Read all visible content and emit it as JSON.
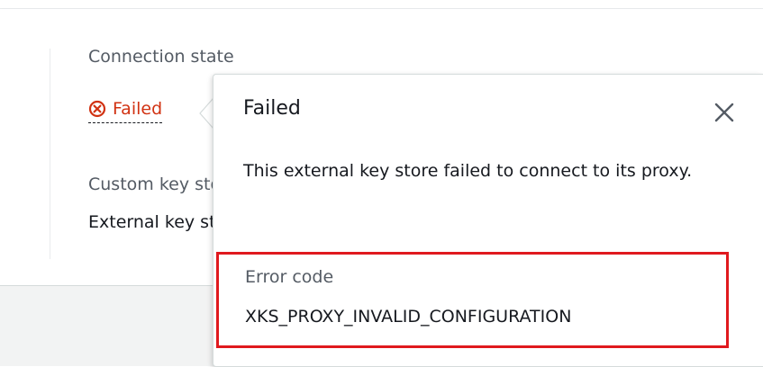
{
  "details": {
    "connection_state_label": "Connection state",
    "connection_state_value": "Failed",
    "custom_key_store_label": "Custom key store type",
    "custom_key_store_value": "External key store"
  },
  "popover": {
    "title": "Failed",
    "description": "This external key store failed to connect to its proxy.",
    "error_code_label": "Error code",
    "error_code_value": "XKS_PROXY_INVALID_CONFIGURATION"
  },
  "icons": {
    "status": "error-circle-x-icon",
    "close": "close-icon"
  },
  "colors": {
    "error": "#d13212",
    "highlight_border": "#e0191e",
    "text_primary": "#16191f",
    "text_secondary": "#545b64"
  }
}
